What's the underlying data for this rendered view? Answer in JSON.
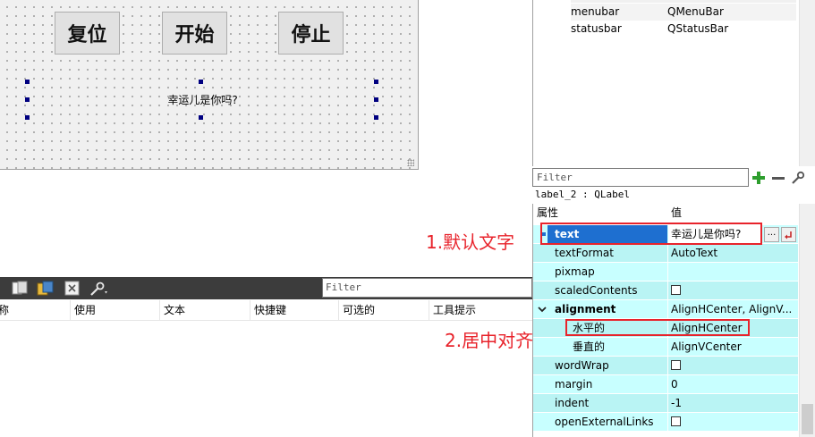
{
  "canvas": {
    "buttons": [
      "复位",
      "开始",
      "停止"
    ],
    "label_text": "幸运儿是你吗?"
  },
  "object_inspector": {
    "rows": [
      {
        "name": "menubar",
        "class": "QMenuBar"
      },
      {
        "name": "statusbar",
        "class": "QStatusBar"
      }
    ]
  },
  "property_editor": {
    "filter_placeholder": "Filter",
    "object_title": "label_2 : QLabel",
    "header_property": "属性",
    "header_value": "值",
    "rows": [
      {
        "name": "text",
        "value": "幸运儿是你吗?"
      },
      {
        "name": "textFormat",
        "value": "AutoText"
      },
      {
        "name": "pixmap",
        "value": ""
      },
      {
        "name": "scaledContents",
        "value": ""
      },
      {
        "name": "alignment",
        "value": "AlignHCenter, AlignV..."
      },
      {
        "name": "水平的",
        "value": "AlignHCenter"
      },
      {
        "name": "垂直的",
        "value": "AlignVCenter"
      },
      {
        "name": "wordWrap",
        "value": ""
      },
      {
        "name": "margin",
        "value": "0"
      },
      {
        "name": "indent",
        "value": "-1"
      },
      {
        "name": "openExternalLinks",
        "value": ""
      }
    ],
    "browse_label": "..."
  },
  "action_editor": {
    "filter_placeholder": "Filter",
    "columns": [
      "称",
      "使用",
      "文本",
      "快捷键",
      "可选的",
      "工具提示"
    ]
  },
  "annotations": {
    "label1": "1.默认文字",
    "label2": "2.居中对齐"
  },
  "colors": {
    "annotation": "#e8232b",
    "selection": "#1e6fd0",
    "property_row": "#c8ffff",
    "toolbar": "#3c3c3c"
  }
}
